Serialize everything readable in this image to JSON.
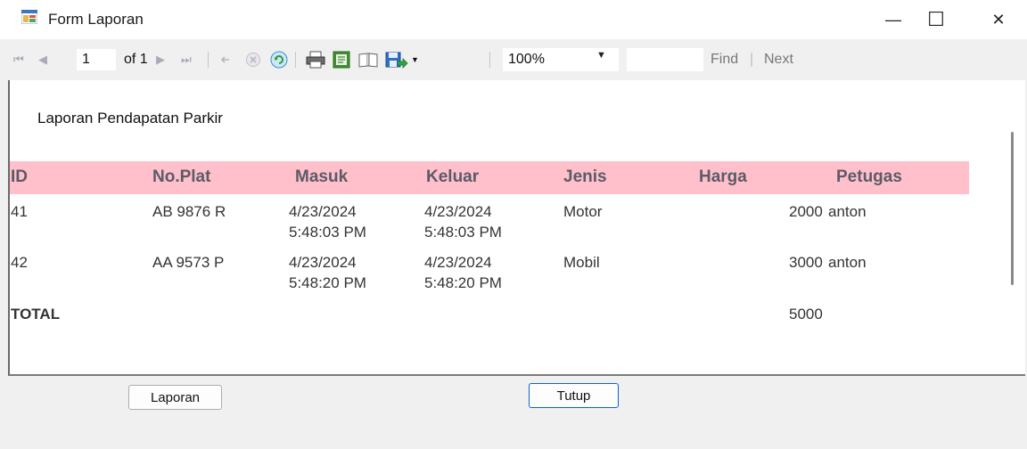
{
  "window": {
    "title": "Form Laporan",
    "minimize_glyph": "—",
    "maximize_glyph": "☐",
    "close_glyph": "✕"
  },
  "toolbar": {
    "first_glyph": "⏮",
    "prev_glyph": "◀",
    "page_current": "1",
    "page_of": "of 1",
    "next_glyph": "▶",
    "last_glyph": "⏭",
    "zoom": "100%",
    "find_label": "Find",
    "separator": "|",
    "next_label": "Next"
  },
  "report": {
    "title": "Laporan Pendapatan Parkir",
    "columns": [
      "ID",
      "No.Plat",
      "Masuk",
      "Keluar",
      "Jenis",
      "Harga",
      "Petugas"
    ],
    "rows": [
      {
        "id": "41",
        "plat": "AB 9876 R",
        "masuk_date": "4/23/2024",
        "masuk_time": "5:48:03 PM",
        "keluar_date": "4/23/2024",
        "keluar_time": "5:48:03 PM",
        "jenis": "Motor",
        "harga": "2000",
        "petugas": "anton"
      },
      {
        "id": "42",
        "plat": "AA 9573 P",
        "masuk_date": "4/23/2024",
        "masuk_time": "5:48:20 PM",
        "keluar_date": "4/23/2024",
        "keluar_time": "5:48:20 PM",
        "jenis": "Mobil",
        "harga": "3000",
        "petugas": "anton"
      }
    ],
    "total_label": "TOTAL",
    "total_value": "5000",
    "header_color": "#ffc0cb"
  },
  "buttons": {
    "laporan": "Laporan",
    "tutup": "Tutup"
  },
  "icons": {
    "app": "form-app-icon",
    "back": "back-arrow-icon",
    "stop": "stop-icon",
    "refresh": "refresh-icon",
    "print": "print-icon",
    "print_layout": "print-layout-icon",
    "page_setup": "page-setup-icon",
    "export": "export-save-icon"
  }
}
